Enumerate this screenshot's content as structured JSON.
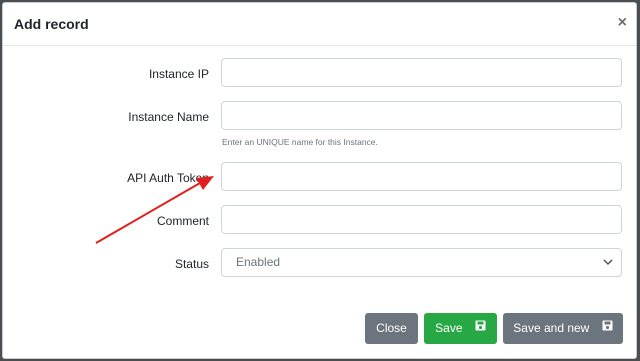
{
  "modal": {
    "title": "Add record",
    "close_glyph": "×"
  },
  "fields": {
    "instance_ip": {
      "label": "Instance IP",
      "value": "",
      "placeholder": ""
    },
    "instance_name": {
      "label": "Instance Name",
      "value": "",
      "placeholder": "",
      "help": "Enter an UNIQUE name for this Instance."
    },
    "api_auth_token": {
      "label": "API Auth Token",
      "value": "",
      "placeholder": ""
    },
    "comment": {
      "label": "Comment",
      "value": "",
      "placeholder": ""
    },
    "status": {
      "label": "Status",
      "selected": "Enabled"
    }
  },
  "buttons": {
    "close": "Close",
    "save": "Save",
    "save_and_new": "Save and new"
  },
  "icons": {
    "close": "close-icon",
    "save": "floppy-disk-icon",
    "chevron": "chevron-down-icon"
  },
  "colors": {
    "save_green": "#28a745",
    "secondary_gray": "#6c757d",
    "annotation_arrow": "#e02020"
  }
}
